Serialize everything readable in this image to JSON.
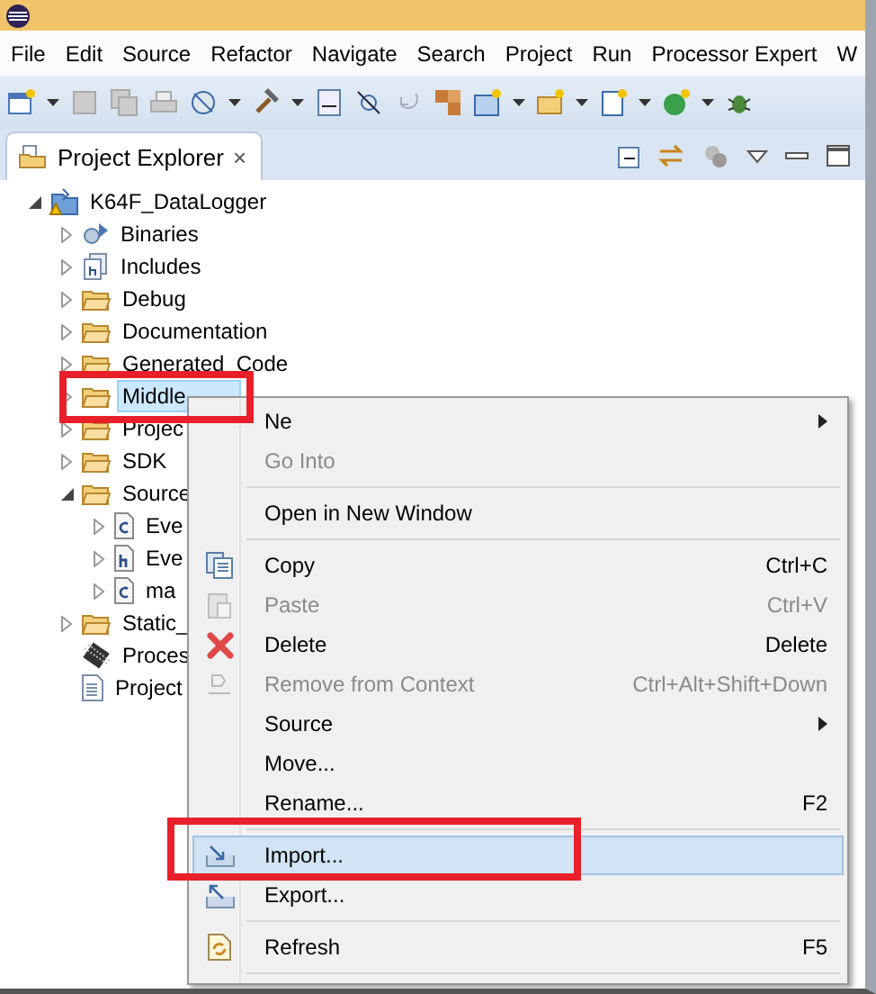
{
  "menu_bar": [
    {
      "label": "File"
    },
    {
      "label": "Edit"
    },
    {
      "label": "Source"
    },
    {
      "label": "Refactor"
    },
    {
      "label": "Navigate"
    },
    {
      "label": "Search"
    },
    {
      "label": "Project"
    },
    {
      "label": "Run"
    },
    {
      "label": "Processor Expert"
    },
    {
      "label": "W"
    }
  ],
  "panel": {
    "tab": {
      "label": "Project Explorer",
      "selected": true,
      "close": "×"
    }
  },
  "tree": [
    {
      "label": "K64F_DataLogger",
      "kind": "project",
      "expanded": true,
      "selected": false,
      "children": [
        {
          "label": "Binaries",
          "kind": "binaries",
          "expanded": false,
          "selected": false
        },
        {
          "label": "Includes",
          "kind": "includes",
          "expanded": false,
          "selected": false
        },
        {
          "label": "Debug",
          "kind": "folder",
          "expanded": false,
          "selected": false
        },
        {
          "label": "Documentation",
          "kind": "folder",
          "expanded": false,
          "selected": false
        },
        {
          "label": "Generated_Code",
          "kind": "folder",
          "expanded": false,
          "selected": false
        },
        {
          "label": "Middle",
          "kind": "folder",
          "expanded": false,
          "selected": true
        },
        {
          "label": "Projec",
          "kind": "folder",
          "expanded": false,
          "selected": false
        },
        {
          "label": "SDK",
          "kind": "folder",
          "expanded": false,
          "selected": false
        },
        {
          "label": "Source",
          "kind": "folder",
          "expanded": true,
          "selected": false,
          "children": [
            {
              "label": "Eve",
              "kind": "c-file",
              "expanded": false,
              "selected": false
            },
            {
              "label": "Eve",
              "kind": "h-file",
              "expanded": false,
              "selected": false
            },
            {
              "label": "ma",
              "kind": "c-file",
              "expanded": false,
              "selected": false
            }
          ]
        },
        {
          "label": "Static_",
          "kind": "folder",
          "expanded": false,
          "selected": false
        },
        {
          "label": "Proces",
          "kind": "chip",
          "selected": false
        },
        {
          "label": "Project",
          "kind": "file",
          "selected": false
        }
      ]
    }
  ],
  "context_menu": [
    {
      "kind": "plain",
      "label": "Ne",
      "submenu": true,
      "disabled": false,
      "selected": false
    },
    {
      "kind": "plain",
      "label": "Go Into",
      "disabled": true,
      "selected": false
    },
    {
      "kind": "separator"
    },
    {
      "kind": "plain",
      "label": "Open in New Window",
      "disabled": false,
      "selected": false
    },
    {
      "kind": "separator"
    },
    {
      "kind": "copy",
      "label": "Copy",
      "shortcut": "Ctrl+C",
      "disabled": false,
      "selected": false
    },
    {
      "kind": "paste",
      "label": "Paste",
      "shortcut": "Ctrl+V",
      "disabled": true,
      "selected": false
    },
    {
      "kind": "delete",
      "label": "Delete",
      "shortcut": "Delete",
      "disabled": false,
      "selected": false
    },
    {
      "kind": "remove",
      "label": "Remove from Context",
      "shortcut": "Ctrl+Alt+Shift+Down",
      "disabled": true,
      "selected": false
    },
    {
      "kind": "plain",
      "label": "Source",
      "submenu": true,
      "disabled": false,
      "selected": false
    },
    {
      "kind": "plain",
      "label": "Move...",
      "disabled": false,
      "selected": false
    },
    {
      "kind": "plain",
      "label": "Rename...",
      "shortcut": "F2",
      "disabled": false,
      "selected": false
    },
    {
      "kind": "separator"
    },
    {
      "kind": "import",
      "label": "Import...",
      "disabled": false,
      "selected": true
    },
    {
      "kind": "export",
      "label": "Export...",
      "disabled": false,
      "selected": false
    },
    {
      "kind": "separator"
    },
    {
      "kind": "refresh",
      "label": "Refresh",
      "shortcut": "F5",
      "disabled": false,
      "selected": false
    },
    {
      "kind": "separator"
    }
  ]
}
